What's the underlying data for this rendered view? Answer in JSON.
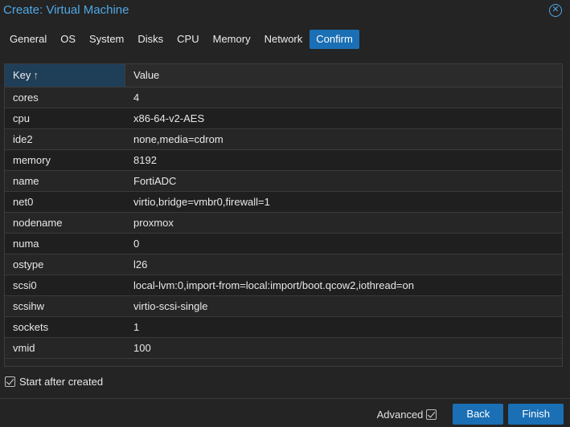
{
  "window": {
    "title": "Create: Virtual Machine",
    "close_icon": "close-icon"
  },
  "tabs": [
    {
      "label": "General",
      "active": false
    },
    {
      "label": "OS",
      "active": false
    },
    {
      "label": "System",
      "active": false
    },
    {
      "label": "Disks",
      "active": false
    },
    {
      "label": "CPU",
      "active": false
    },
    {
      "label": "Memory",
      "active": false
    },
    {
      "label": "Network",
      "active": false
    },
    {
      "label": "Confirm",
      "active": true
    }
  ],
  "grid": {
    "headers": {
      "key": "Key",
      "value": "Value",
      "sort_icon": "↑"
    },
    "rows": [
      {
        "key": "cores",
        "value": "4"
      },
      {
        "key": "cpu",
        "value": "x86-64-v2-AES"
      },
      {
        "key": "ide2",
        "value": "none,media=cdrom"
      },
      {
        "key": "memory",
        "value": "8192"
      },
      {
        "key": "name",
        "value": "FortiADC"
      },
      {
        "key": "net0",
        "value": "virtio,bridge=vmbr0,firewall=1"
      },
      {
        "key": "nodename",
        "value": "proxmox"
      },
      {
        "key": "numa",
        "value": "0"
      },
      {
        "key": "ostype",
        "value": "l26"
      },
      {
        "key": "scsi0",
        "value": "local-lvm:0,import-from=local:import/boot.qcow2,iothread=on"
      },
      {
        "key": "scsihw",
        "value": "virtio-scsi-single"
      },
      {
        "key": "sockets",
        "value": "1"
      },
      {
        "key": "vmid",
        "value": "100"
      }
    ]
  },
  "start_after_created": {
    "label": "Start after created",
    "checked": true
  },
  "footer": {
    "advanced_label": "Advanced",
    "advanced_checked": true,
    "back_label": "Back",
    "finish_label": "Finish"
  },
  "colors": {
    "accent": "#1a6fb5",
    "title": "#4fa8e6",
    "background": "#242424"
  }
}
